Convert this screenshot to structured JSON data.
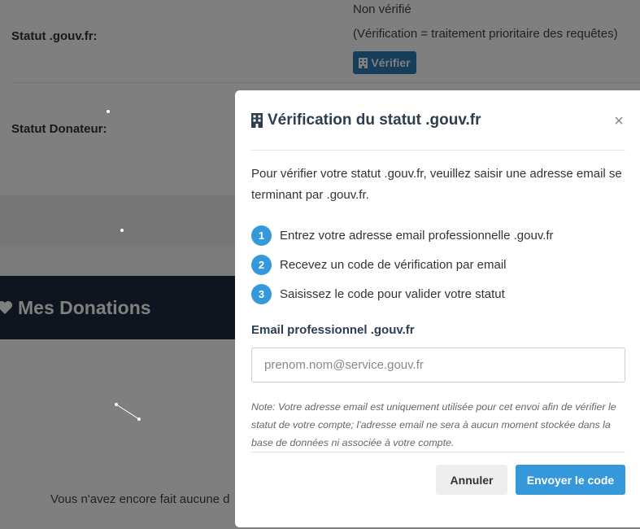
{
  "background": {
    "gouv_status": {
      "label": "Statut .gouv.fr:",
      "value": "Non vérifié",
      "note": "(Vérification = traitement prioritaire des requêtes)",
      "verify_button": "Vérifier"
    },
    "donor_status": {
      "label": "Statut Donateur:"
    },
    "donations": {
      "title": "Mes Donations",
      "empty_text": "Vous n'avez encore fait aucune d"
    }
  },
  "modal": {
    "title": "Vérification du statut .gouv.fr",
    "close": "×",
    "intro": "Pour vérifier votre statut .gouv.fr, veuillez saisir une adresse email se terminant par .gouv.fr.",
    "steps": [
      {
        "num": "1",
        "text": "Entrez votre adresse email professionnelle .gouv.fr"
      },
      {
        "num": "2",
        "text": "Recevez un code de vérification par email"
      },
      {
        "num": "3",
        "text": "Saisissez le code pour valider votre statut"
      }
    ],
    "email_label": "Email professionnel .gouv.fr",
    "email_placeholder": "prenom.nom@service.gouv.fr",
    "email_value": "",
    "note": "Note: Votre adresse email est uniquement utilisée pour cet envoi afin de vérifier le statut de votre compte; l'adresse email ne sera à aucun moment stockée dans la base de données ni associée à votre compte.",
    "cancel_button": "Annuler",
    "send_button": "Envoyer le code"
  },
  "colors": {
    "primary": "#3498db",
    "verify_button": "#2d7ab5",
    "header_bg": "#1d2b3c",
    "overlay": "rgba(0,0,0,0.5)"
  },
  "icons": {
    "building": "building-icon",
    "heart": "heart-icon",
    "close": "close-icon"
  }
}
